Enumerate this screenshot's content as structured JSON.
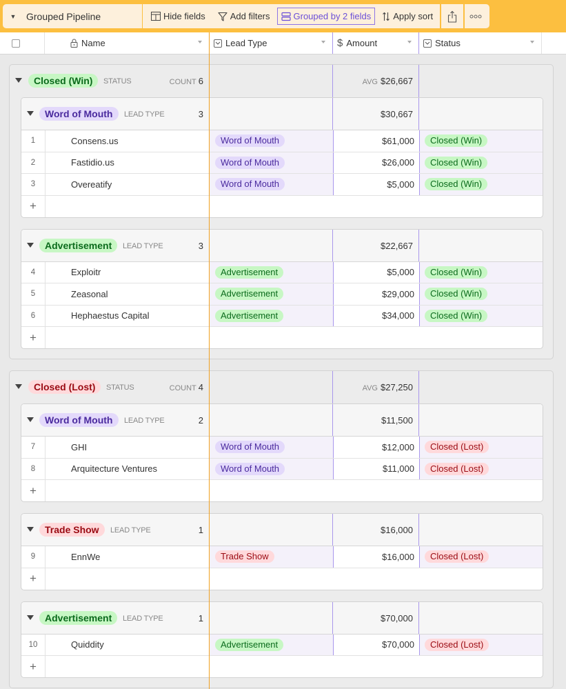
{
  "toolbar": {
    "view_name": "Grouped Pipeline",
    "hide_fields": "Hide fields",
    "add_filters": "Add filters",
    "grouped_by": "Grouped by 2 fields",
    "apply_sort": "Apply sort"
  },
  "columns": {
    "name": "Name",
    "lead_type": "Lead Type",
    "amount": "Amount",
    "status": "Status"
  },
  "labels": {
    "status_field": "STATUS",
    "lead_type_field": "LEAD TYPE",
    "count": "COUNT",
    "avg": "AVG",
    "add_row": "+"
  },
  "colors": {
    "toolbar_bg": "#fcbf40",
    "win_bg": "#c7f7c4",
    "win_fg": "#0b6b1c",
    "lost_bg": "#ffd9db",
    "lost_fg": "#9a0a12",
    "wom_bg": "#e3d9fb",
    "wom_fg": "#4a2a9e",
    "ad_bg": "#c7f7c4",
    "ad_fg": "#0b6b1c",
    "trade_bg": "#ffd9db",
    "trade_fg": "#9a0a12",
    "grouped_accent": "#8d74e6",
    "frozen_line": "#f0a020"
  },
  "groups": [
    {
      "status": "Closed (Win)",
      "count": "6",
      "avg": "$26,667",
      "subgroups": [
        {
          "lead_type": "Word of Mouth",
          "count": "3",
          "total": "$30,667",
          "rows": [
            {
              "num": "1",
              "name": "Consens.us",
              "lead_type": "Word of Mouth",
              "amount": "$61,000",
              "status": "Closed (Win)"
            },
            {
              "num": "2",
              "name": "Fastidio.us",
              "lead_type": "Word of Mouth",
              "amount": "$26,000",
              "status": "Closed (Win)"
            },
            {
              "num": "3",
              "name": "Overeatify",
              "lead_type": "Word of Mouth",
              "amount": "$5,000",
              "status": "Closed (Win)"
            }
          ]
        },
        {
          "lead_type": "Advertisement",
          "count": "3",
          "total": "$22,667",
          "rows": [
            {
              "num": "4",
              "name": "Exploitr",
              "lead_type": "Advertisement",
              "amount": "$5,000",
              "status": "Closed (Win)"
            },
            {
              "num": "5",
              "name": "Zeasonal",
              "lead_type": "Advertisement",
              "amount": "$29,000",
              "status": "Closed (Win)"
            },
            {
              "num": "6",
              "name": "Hephaestus Capital",
              "lead_type": "Advertisement",
              "amount": "$34,000",
              "status": "Closed (Win)"
            }
          ]
        }
      ]
    },
    {
      "status": "Closed (Lost)",
      "count": "4",
      "avg": "$27,250",
      "subgroups": [
        {
          "lead_type": "Word of Mouth",
          "count": "2",
          "total": "$11,500",
          "rows": [
            {
              "num": "7",
              "name": "GHI",
              "lead_type": "Word of Mouth",
              "amount": "$12,000",
              "status": "Closed (Lost)"
            },
            {
              "num": "8",
              "name": "Arquitecture Ventures",
              "lead_type": "Word of Mouth",
              "amount": "$11,000",
              "status": "Closed (Lost)"
            }
          ]
        },
        {
          "lead_type": "Trade Show",
          "count": "1",
          "total": "$16,000",
          "rows": [
            {
              "num": "9",
              "name": "EnnWe",
              "lead_type": "Trade Show",
              "amount": "$16,000",
              "status": "Closed (Lost)"
            }
          ]
        },
        {
          "lead_type": "Advertisement",
          "count": "1",
          "total": "$70,000",
          "rows": [
            {
              "num": "10",
              "name": "Quiddity",
              "lead_type": "Advertisement",
              "amount": "$70,000",
              "status": "Closed (Lost)"
            }
          ]
        }
      ]
    }
  ]
}
